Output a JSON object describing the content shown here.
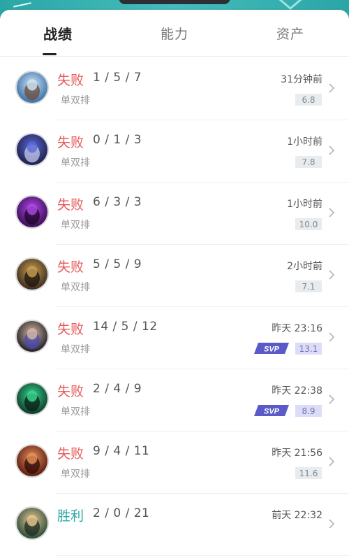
{
  "tabs": [
    {
      "label": "战绩",
      "active": true
    },
    {
      "label": "能力",
      "active": false
    },
    {
      "label": "资产",
      "active": false
    }
  ],
  "colors": {
    "accent": "#2aa6a6",
    "loss": "#e85c5c",
    "svp_badge": "#5a5ac8"
  },
  "matches": [
    {
      "result": "失败",
      "kda": "1 / 5 / 7",
      "mode": "单双排",
      "time": "31分钟前",
      "score": "6.8",
      "svp": false,
      "hero_icon": "champion-portrait-icon"
    },
    {
      "result": "失败",
      "kda": "0 / 1 / 3",
      "mode": "单双排",
      "time": "1小时前",
      "score": "7.8",
      "svp": false,
      "hero_icon": "champion-portrait-icon"
    },
    {
      "result": "失败",
      "kda": "6 / 3 / 3",
      "mode": "单双排",
      "time": "1小时前",
      "score": "10.0",
      "svp": false,
      "hero_icon": "champion-portrait-icon"
    },
    {
      "result": "失败",
      "kda": "5 / 5 / 9",
      "mode": "单双排",
      "time": "2小时前",
      "score": "7.1",
      "svp": false,
      "hero_icon": "champion-portrait-icon"
    },
    {
      "result": "失败",
      "kda": "14 / 5 / 12",
      "mode": "单双排",
      "time": "昨天 23:16",
      "score": "13.1",
      "svp": true,
      "hero_icon": "champion-portrait-icon"
    },
    {
      "result": "失败",
      "kda": "2 / 4 / 9",
      "mode": "单双排",
      "time": "昨天 22:38",
      "score": "8.9",
      "svp": true,
      "hero_icon": "champion-portrait-icon"
    },
    {
      "result": "失败",
      "kda": "9 / 4 / 11",
      "mode": "单双排",
      "time": "昨天 21:56",
      "score": "11.6",
      "svp": false,
      "hero_icon": "champion-portrait-icon"
    },
    {
      "result": "胜利",
      "kda": "2 / 0 / 21",
      "mode": "",
      "time": "前天 22:32",
      "score": "",
      "svp": false,
      "hero_icon": "champion-portrait-icon"
    }
  ]
}
